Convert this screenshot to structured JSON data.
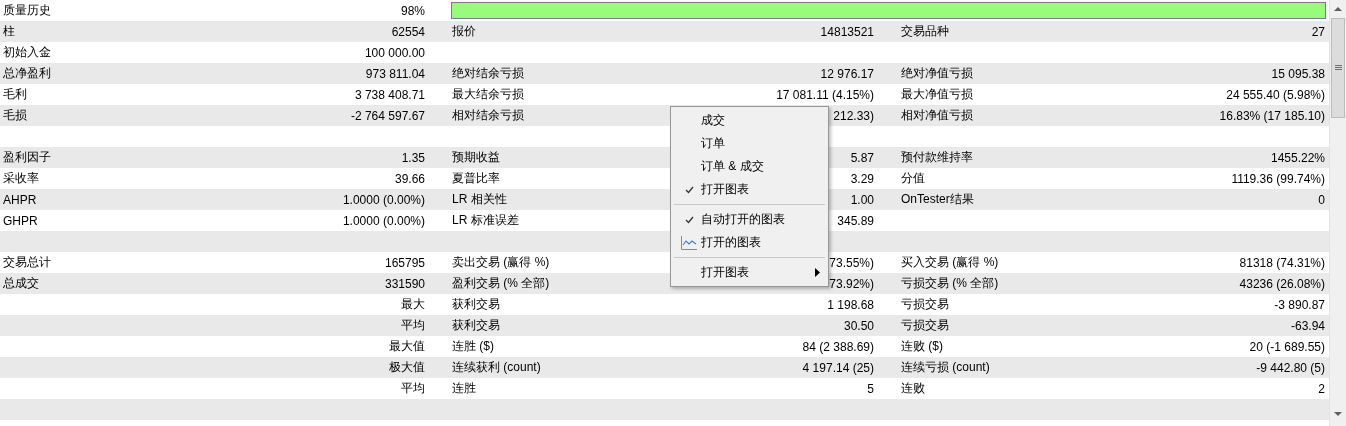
{
  "rows": [
    {
      "kind": "quality",
      "cells": [
        {
          "label": "质量历史",
          "value": "98%"
        }
      ],
      "level": 1.0
    },
    {
      "kind": "stats",
      "cells": [
        {
          "label": "柱",
          "value": "62554"
        },
        {
          "label": "报价",
          "value": "14813521"
        },
        {
          "label": "交易品种",
          "value": "27"
        }
      ]
    },
    {
      "kind": "stats",
      "cells": [
        {
          "label": "初始入金",
          "value": "100 000.00"
        }
      ]
    },
    {
      "kind": "stats",
      "cells": [
        {
          "label": "总净盈利",
          "value": "973 811.04"
        },
        {
          "label": "绝对结余亏损",
          "value": "12 976.17"
        },
        {
          "label": "绝对净值亏损",
          "value": "15 095.38"
        }
      ]
    },
    {
      "kind": "stats",
      "cells": [
        {
          "label": "毛利",
          "value": "3 738 408.71"
        },
        {
          "label": "最大结余亏损",
          "value": "17 081.11 (4.15%)"
        },
        {
          "label": "最大净值亏损",
          "value": "24 555.40 (5.98%)"
        }
      ]
    },
    {
      "kind": "stats",
      "cells": [
        {
          "label": "毛损",
          "value": "-2 764 597.67"
        },
        {
          "label": "相对结余亏损",
          "value": "212.33)"
        },
        {
          "label": "相对净值亏损",
          "value": "16.83% (17 185.10)"
        }
      ]
    },
    {
      "kind": "blank"
    },
    {
      "kind": "stats",
      "cells": [
        {
          "label": "盈利因子",
          "value": "1.35"
        },
        {
          "label": "预期收益",
          "value": "5.87"
        },
        {
          "label": "预付款维持率",
          "value": "1455.22%"
        }
      ]
    },
    {
      "kind": "stats",
      "cells": [
        {
          "label": "采收率",
          "value": "39.66"
        },
        {
          "label": "夏普比率",
          "value": "3.29"
        },
        {
          "label": "分值",
          "value": "1119.36 (99.74%)"
        }
      ]
    },
    {
      "kind": "stats",
      "cells": [
        {
          "label": "AHPR",
          "value": "1.0000 (0.00%)"
        },
        {
          "label": "LR 相关性",
          "value": "1.00"
        },
        {
          "label": "OnTester结果",
          "value": "0"
        }
      ]
    },
    {
      "kind": "stats",
      "cells": [
        {
          "label": "GHPR",
          "value": "1.0000 (0.00%)"
        },
        {
          "label": "LR 标准误差",
          "value": "345.89"
        },
        {}
      ]
    },
    {
      "kind": "blank"
    },
    {
      "kind": "stats",
      "cells": [
        {
          "label": "交易总计",
          "value": "165795"
        },
        {
          "label": "卖出交易 (赢得 %)",
          "value": "73.55%)"
        },
        {
          "label": "买入交易 (赢得 %)",
          "value": "81318 (74.31%)"
        }
      ]
    },
    {
      "kind": "stats",
      "cells": [
        {
          "label": "总成交",
          "value": "331590"
        },
        {
          "label": "盈利交易 (% 全部)",
          "value": "73.92%)"
        },
        {
          "label": "亏损交易 (% 全部)",
          "value": "43236 (26.08%)"
        }
      ]
    },
    {
      "kind": "stats",
      "cells": [
        {
          "value": "最大"
        },
        {
          "label": "获利交易",
          "value": "1 198.68"
        },
        {
          "label": "亏损交易",
          "value": "-3 890.87"
        }
      ]
    },
    {
      "kind": "stats",
      "cells": [
        {
          "value": "平均"
        },
        {
          "label": "获利交易",
          "value": "30.50"
        },
        {
          "label": "亏损交易",
          "value": "-63.94"
        }
      ]
    },
    {
      "kind": "stats",
      "cells": [
        {
          "value": "最大值"
        },
        {
          "label": "连胜 ($)",
          "value": "84 (2 388.69)"
        },
        {
          "label": "连败 ($)",
          "value": "20 (-1 689.55)"
        }
      ]
    },
    {
      "kind": "stats",
      "cells": [
        {
          "value": "极大值"
        },
        {
          "label": "连续获利 (count)",
          "value": "4 197.14 (25)"
        },
        {
          "label": "连续亏损 (count)",
          "value": "-9 442.80 (5)"
        }
      ]
    },
    {
      "kind": "stats",
      "cells": [
        {
          "value": "平均"
        },
        {
          "label": "连胜",
          "value": "5"
        },
        {
          "label": "连败",
          "value": "2"
        }
      ]
    },
    {
      "kind": "blank"
    }
  ],
  "context_menu": [
    {
      "kind": "item",
      "label": "成交",
      "checked": false
    },
    {
      "kind": "item",
      "label": "订单",
      "checked": false
    },
    {
      "kind": "item",
      "label": "订单 & 成交",
      "checked": false
    },
    {
      "kind": "item",
      "label": "打开图表",
      "checked": true
    },
    {
      "kind": "separator"
    },
    {
      "kind": "item",
      "label": "自动打开的图表",
      "checked": true
    },
    {
      "kind": "chart-item",
      "label": "打开的图表"
    },
    {
      "kind": "separator"
    },
    {
      "kind": "submenu",
      "label": "打开图表"
    }
  ]
}
